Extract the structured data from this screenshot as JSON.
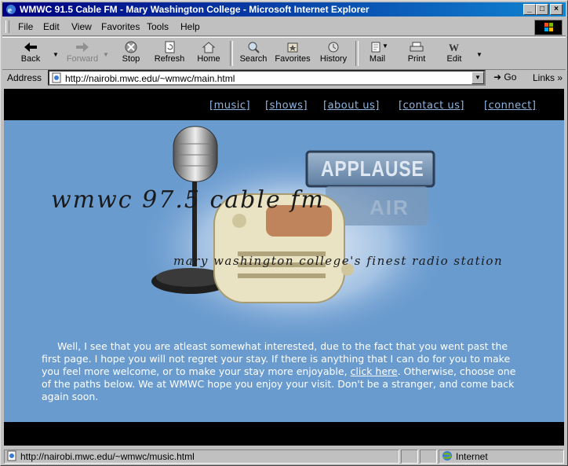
{
  "window": {
    "title": "WMWC 91.5 Cable FM - Mary Washington College - Microsoft Internet Explorer",
    "controls": [
      "_",
      "□",
      "×"
    ]
  },
  "menubar": {
    "items": [
      {
        "label": "File",
        "key": "F"
      },
      {
        "label": "Edit",
        "key": "E"
      },
      {
        "label": "View",
        "key": "V"
      },
      {
        "label": "Favorites",
        "key": "a"
      },
      {
        "label": "Tools",
        "key": "T"
      },
      {
        "label": "Help",
        "key": "H"
      }
    ]
  },
  "toolbar": {
    "buttons": [
      {
        "label": "Back",
        "icon": "back-arrow-icon",
        "enabled": true
      },
      {
        "label": "Forward",
        "icon": "forward-arrow-icon",
        "enabled": false
      },
      {
        "label": "Stop",
        "icon": "stop-icon",
        "enabled": true
      },
      {
        "label": "Refresh",
        "icon": "refresh-icon",
        "enabled": true
      },
      {
        "label": "Home",
        "icon": "home-icon",
        "enabled": true
      },
      {
        "label": "Search",
        "icon": "search-icon",
        "enabled": true
      },
      {
        "label": "Favorites",
        "icon": "favorites-icon",
        "enabled": true
      },
      {
        "label": "History",
        "icon": "history-icon",
        "enabled": true
      },
      {
        "label": "Mail",
        "icon": "mail-icon",
        "enabled": true
      },
      {
        "label": "Print",
        "icon": "print-icon",
        "enabled": true
      },
      {
        "label": "Edit",
        "icon": "edit-icon",
        "enabled": true
      }
    ]
  },
  "address": {
    "label": "Address",
    "url": "http://nairobi.mwc.edu/~wmwc/main.html",
    "go_label": "Go",
    "links_label": "Links"
  },
  "page": {
    "nav": [
      "[music]",
      "[shows]",
      "[about us]",
      "[contact us]",
      "[connect]"
    ],
    "banner_title": "wmwc 97.5 cable fm",
    "banner_tagline": "mary washington college's finest radio station",
    "sign_top": "APPLAUSE",
    "sign_bottom": "AIR",
    "intro_before_link": "Well, I see that you are atleast somewhat interested, due to the fact that you went past the first page. I hope you will not regret your stay. If there is anything that I can do for you to make you feel more welcome, or to make your stay more enjoyable, ",
    "intro_link": "click here",
    "intro_after_link": ". Otherwise, choose one of the paths below. We at WMWC hope you enjoy your visit. Don't be a stranger, and come back again soon.",
    "colors": {
      "background": "#6a9bcf",
      "band": "#000000",
      "nav_link": "#8eb6e0"
    }
  },
  "statusbar": {
    "text": "http://nairobi.mwc.edu/~wmwc/music.html",
    "zone": "Internet"
  }
}
